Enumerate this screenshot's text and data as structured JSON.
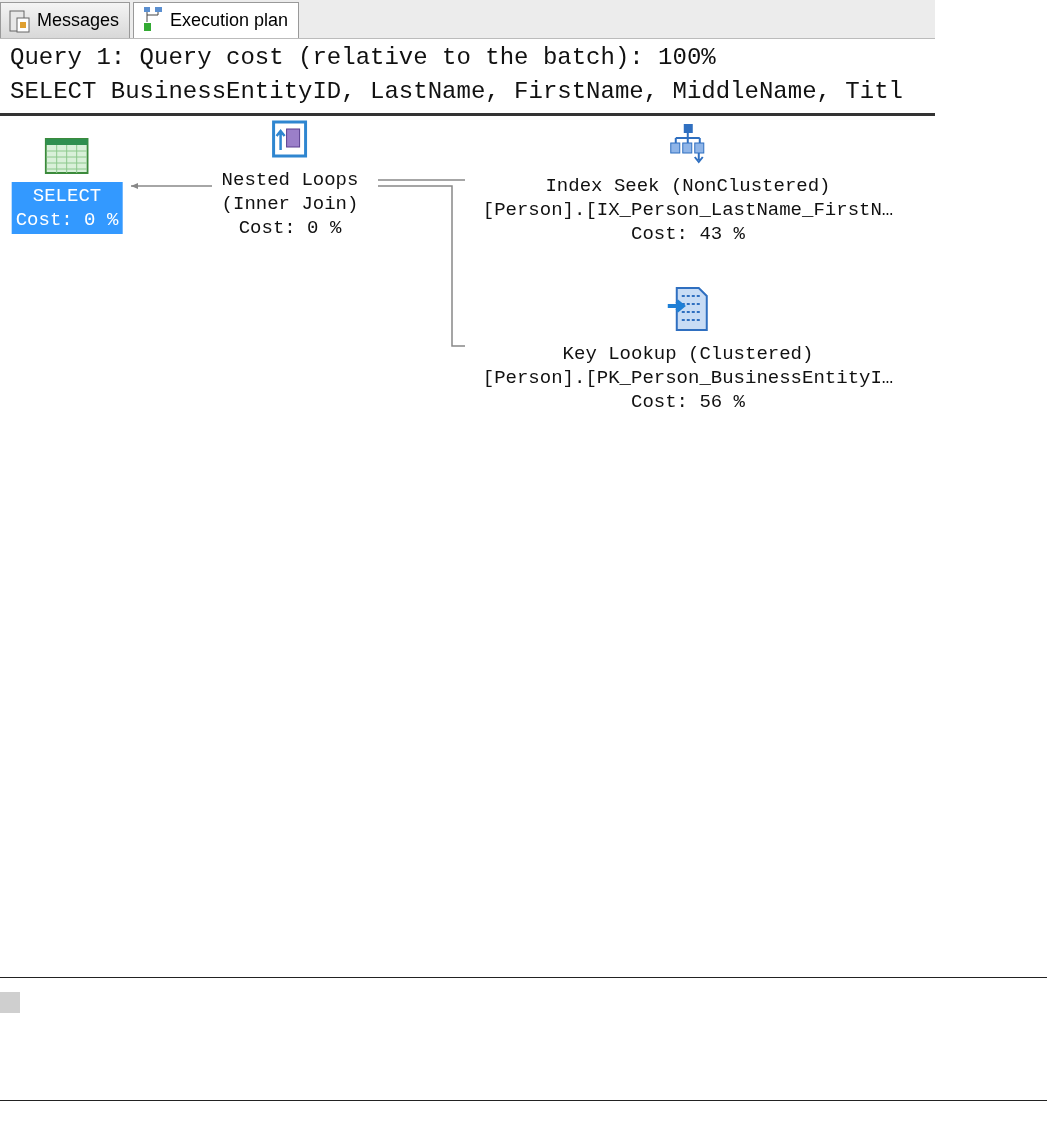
{
  "tabs": [
    {
      "label": "Messages",
      "kind": "messages",
      "selected": false
    },
    {
      "label": "Execution plan",
      "kind": "plan",
      "selected": true
    }
  ],
  "header": {
    "cost_line": "Query 1: Query cost (relative to the batch): 100%",
    "sql_line": "SELECT BusinessEntityID, LastName, FirstName, MiddleName, Titl"
  },
  "plan_nodes": [
    {
      "kind": "select",
      "selected": true,
      "lines": [
        "SELECT",
        "Cost: 0 %"
      ]
    },
    {
      "kind": "nested_loops",
      "selected": false,
      "lines": [
        "Nested Loops",
        "(Inner Join)",
        "Cost: 0 %"
      ]
    },
    {
      "kind": "index_seek",
      "selected": false,
      "lines": [
        "Index Seek (NonClustered)",
        "[Person].[IX_Person_LastName_FirstN…",
        "Cost: 43 %"
      ]
    },
    {
      "kind": "key_lookup",
      "selected": false,
      "lines": [
        "Key Lookup (Clustered)",
        "[Person].[PK_Person_BusinessEntityI…",
        "Cost: 56 %"
      ]
    }
  ]
}
